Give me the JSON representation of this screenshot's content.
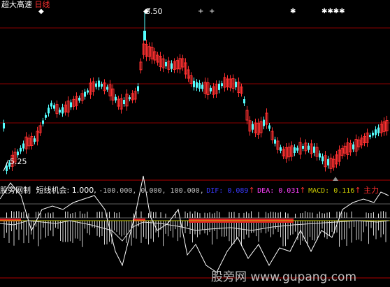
{
  "header": {
    "title": "超大高速",
    "period": "日线",
    "title_color": "#ffffff",
    "period_color": "#ff3030"
  },
  "price_panel": {
    "high_label": "8.50",
    "low_label": "5.25",
    "signal_marks": [
      "◆",
      "◆",
      "+",
      "+",
      "✱",
      "✱✱✱✱"
    ]
  },
  "indicator": {
    "name": "股旁网制",
    "line_label": "短线机会: 1.000,",
    "params": "-100.000, 0.000, 100.000,",
    "dif_label": "DIF: 0.089",
    "dea_label": "DEA: 0.031",
    "macd_label": "MACD: 0.116",
    "main_label": "主力",
    "arrow": "↑",
    "colors": {
      "dif": "#3a3aff",
      "dea": "#ff40ff",
      "macd": "#c8c800",
      "main": "#ff3030",
      "arrow": "#ff3030"
    }
  },
  "watermark": "股旁网 www.gupang.com",
  "colors": {
    "up": "#ff3030",
    "down": "#54ffff",
    "grid": "#8b0000",
    "line": "#ffffff",
    "osc": "#ffffff"
  }
}
